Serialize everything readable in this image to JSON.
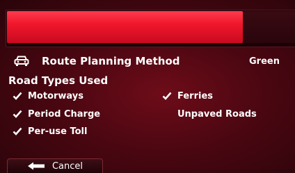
{
  "progress": {
    "fraction": 0.82
  },
  "header": {
    "title": "Route Planning Method",
    "value": "Green"
  },
  "road_types": {
    "heading": "Road Types Used",
    "options": [
      {
        "label": "Motorways",
        "checked": true
      },
      {
        "label": "Period Charge",
        "checked": true
      },
      {
        "label": "Per-use Toll",
        "checked": true
      },
      {
        "label": "Ferries",
        "checked": true
      },
      {
        "label": "Unpaved Roads",
        "checked": false
      }
    ]
  },
  "footer": {
    "cancel_label": "Cancel"
  },
  "icons": {
    "car": "car-icon",
    "check": "check-icon",
    "back": "back-arrow-icon"
  }
}
